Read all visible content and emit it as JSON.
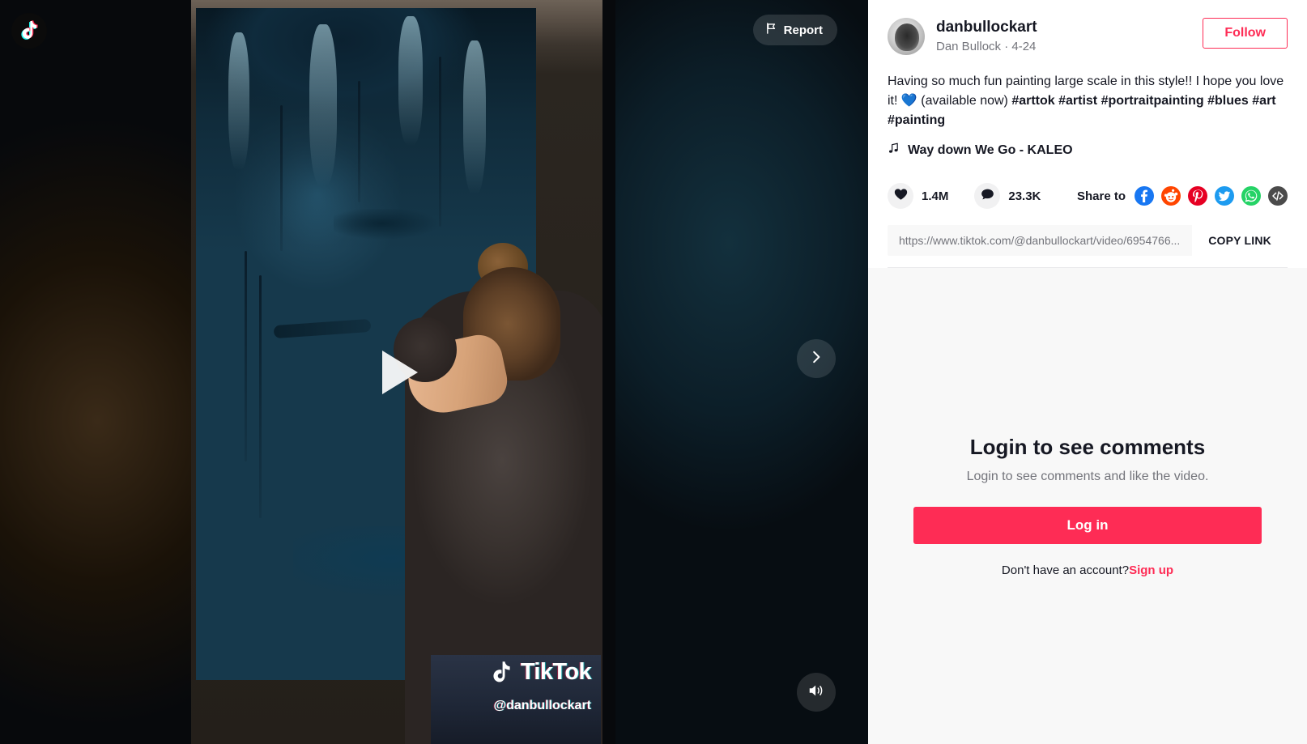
{
  "video": {
    "report_label": "Report",
    "report_icon": "flag-icon",
    "logo_icon": "tiktok-logo-icon",
    "play_icon": "play-icon",
    "next_icon": "chevron-right-icon",
    "volume_icon": "volume-on-icon",
    "watermark_text": "TikTok",
    "watermark_handle": "@danbullockart"
  },
  "author": {
    "username": "danbullockart",
    "subtitle": "Dan Bullock · 4-24",
    "avatar_icon": "avatar",
    "follow_label": "Follow"
  },
  "post": {
    "caption_text": "Having so much fun painting large scale in this style!! I hope you love it! 💙 (available now) ",
    "hashtags": "#arttok #artist #portraitpainting #blues #art #painting",
    "music_icon": "music-note-icon",
    "music_title": "Way down We Go - KALEO"
  },
  "engagement": {
    "like_icon": "heart-icon",
    "like_count": "1.4M",
    "comment_icon": "comment-icon",
    "comment_count": "23.3K",
    "share_label": "Share to",
    "share_targets": [
      {
        "name": "facebook",
        "glyph": "f",
        "color": "#1877f2"
      },
      {
        "name": "reddit",
        "glyph": "●",
        "color": "#ff4500"
      },
      {
        "name": "pinterest",
        "glyph": "P",
        "color": "#e60023"
      },
      {
        "name": "twitter",
        "glyph": "✉",
        "color": "#1d9bf0"
      },
      {
        "name": "whatsapp",
        "glyph": "✆",
        "color": "#25d366"
      },
      {
        "name": "embed",
        "glyph": "</>",
        "color": "#4b4b4b"
      }
    ]
  },
  "copy_link": {
    "url": "https://www.tiktok.com/@danbullockart/video/6954766...",
    "button_label": "COPY LINK"
  },
  "login": {
    "title": "Login to see comments",
    "subtitle": "Login to see comments and like the video.",
    "button_label": "Log in",
    "prompt": "Don't have an account?",
    "signup_label": "Sign up"
  },
  "colors": {
    "accent": "#fe2c55",
    "text": "#161823",
    "muted": "#73747b",
    "panel_bg": "#f8f8f8"
  }
}
